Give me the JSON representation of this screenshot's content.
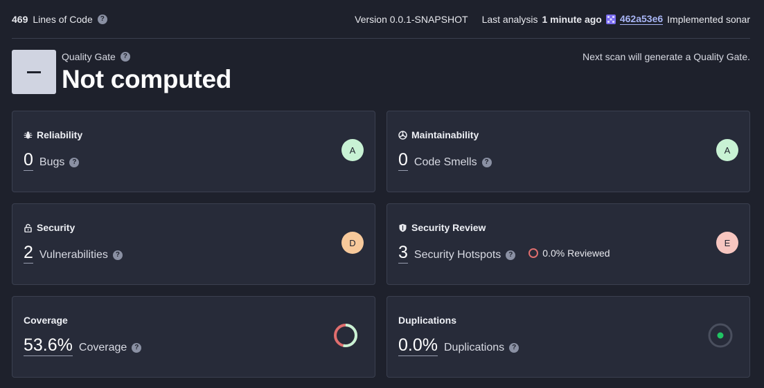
{
  "topbar": {
    "loc_value": "469",
    "loc_label": "Lines of Code",
    "version": "Version 0.0.1-SNAPSHOT",
    "last_analysis_label": "Last analysis",
    "last_analysis_value": "1 minute ago",
    "commit_hash": "462a53e6",
    "commit_message": "Implemented sonar"
  },
  "quality_gate": {
    "label": "Quality Gate",
    "status": "Not computed",
    "note": "Next scan will generate a Quality Gate."
  },
  "cards": {
    "reliability": {
      "title": "Reliability",
      "value": "0",
      "label": "Bugs",
      "rating": "A",
      "rating_color": "#c8f2d4"
    },
    "maintainability": {
      "title": "Maintainability",
      "value": "0",
      "label": "Code Smells",
      "rating": "A",
      "rating_color": "#c8f2d4"
    },
    "security": {
      "title": "Security",
      "value": "2",
      "label": "Vulnerabilities",
      "rating": "D",
      "rating_color": "#f7c99b"
    },
    "security_review": {
      "title": "Security Review",
      "value": "3",
      "label": "Security Hotspots",
      "reviewed": "0.0% Reviewed",
      "rating": "E",
      "rating_color": "#f7c6c0"
    },
    "coverage": {
      "title": "Coverage",
      "value": "53.6%",
      "label": "Coverage",
      "coverage_fraction": 0.536
    },
    "duplications": {
      "title": "Duplications",
      "value": "0.0%",
      "label": "Duplications",
      "dup_fraction": 0.0
    }
  },
  "colors": {
    "background": "#1e212c",
    "card": "#272b39",
    "link": "#a9b6f6",
    "coverage_good": "#c8f2d4",
    "coverage_bad": "#e06e6e",
    "dup_dot": "#20c463"
  },
  "help_glyph": "?"
}
